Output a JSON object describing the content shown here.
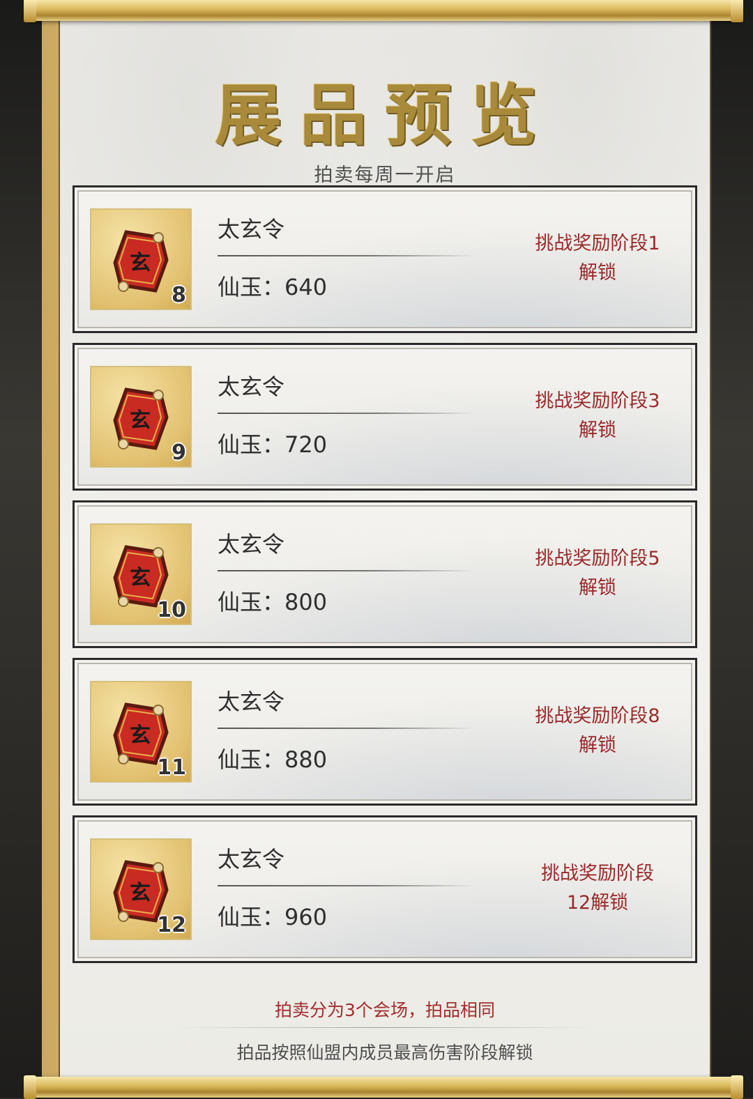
{
  "header": {
    "title": "展品预览",
    "subtitle": "拍卖每周一开启"
  },
  "items": [
    {
      "name": "太玄令",
      "price_label": "仙玉：",
      "price": "640",
      "count": "8",
      "unlock": "挑战奖励阶段1\n解锁"
    },
    {
      "name": "太玄令",
      "price_label": "仙玉：",
      "price": "720",
      "count": "9",
      "unlock": "挑战奖励阶段3\n解锁"
    },
    {
      "name": "太玄令",
      "price_label": "仙玉：",
      "price": "800",
      "count": "10",
      "unlock": "挑战奖励阶段5\n解锁"
    },
    {
      "name": "太玄令",
      "price_label": "仙玉：",
      "price": "880",
      "count": "11",
      "unlock": "挑战奖励阶段8\n解锁"
    },
    {
      "name": "太玄令",
      "price_label": "仙玉：",
      "price": "960",
      "count": "12",
      "unlock": "挑战奖励阶段\n12解锁"
    }
  ],
  "token_glyph": "玄",
  "footer": {
    "notice": "拍卖分为3个会场，拍品相同",
    "note": "拍品按照仙盟内成员最高伤害阶段解锁"
  },
  "colors": {
    "title_gold": "#a88a3a",
    "unlock_red": "#9a2a2a",
    "notice_red": "#a12d2d"
  }
}
